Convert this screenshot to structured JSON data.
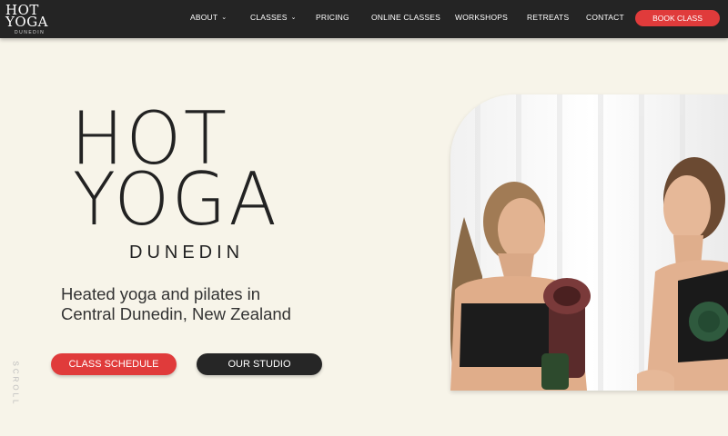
{
  "header": {
    "logo": {
      "line1": "HOT",
      "line2": "YOGA",
      "sub": "DUNEDIN"
    },
    "nav": [
      {
        "label": "ABOUT",
        "dropdown": true
      },
      {
        "label": "CLASSES",
        "dropdown": true
      },
      {
        "label": "PRICING",
        "dropdown": false
      },
      {
        "label": "ONLINE CLASSES",
        "dropdown": false
      },
      {
        "label": "WORKSHOPS",
        "dropdown": false
      },
      {
        "label": "RETREATS",
        "dropdown": false
      },
      {
        "label": "CONTACT",
        "dropdown": false
      }
    ],
    "book_button": "BOOK CLASS"
  },
  "hero": {
    "brand_line1": "HOT",
    "brand_line2": "YOGA",
    "brand_sub": "DUNEDIN",
    "tagline_line1": "Heated yoga and pilates in",
    "tagline_line2": "Central Dunedin, New Zealand",
    "primary_button": "CLASS SCHEDULE",
    "secondary_button": "OUR STUDIO",
    "side_label": "SCROLL"
  },
  "colors": {
    "nav_background": "#242424",
    "page_background": "#f7f4e9",
    "accent_red": "#e03b3b",
    "dark_button": "#262626"
  },
  "icons": {
    "dropdown": "chevron-down-icon"
  }
}
